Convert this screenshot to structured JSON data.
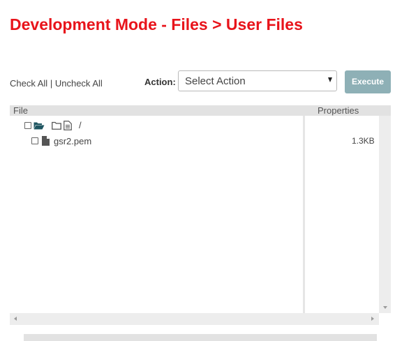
{
  "page": {
    "title": "Development Mode - Files > User Files"
  },
  "toolbar": {
    "check_all": "Check All",
    "separator": "|",
    "uncheck_all": "Uncheck All",
    "action_label": "Action:",
    "action_selected": "Select Action",
    "execute_label": "Execute",
    "execute_color": "#8eb0b6"
  },
  "file_table": {
    "columns": {
      "file": "File",
      "properties": "Properties"
    },
    "rows": [
      {
        "name": "/",
        "type": "root",
        "icons": [
          "folder-open-icon",
          "folder-icon",
          "document-icon"
        ],
        "size": ""
      },
      {
        "name": "gsr2.pem",
        "type": "file",
        "icons": [
          "file-icon"
        ],
        "size": "1.3KB"
      }
    ]
  },
  "colors": {
    "title": "#e8141b",
    "header_bg": "#e2e2e2",
    "folder_open": "#1f5561"
  }
}
